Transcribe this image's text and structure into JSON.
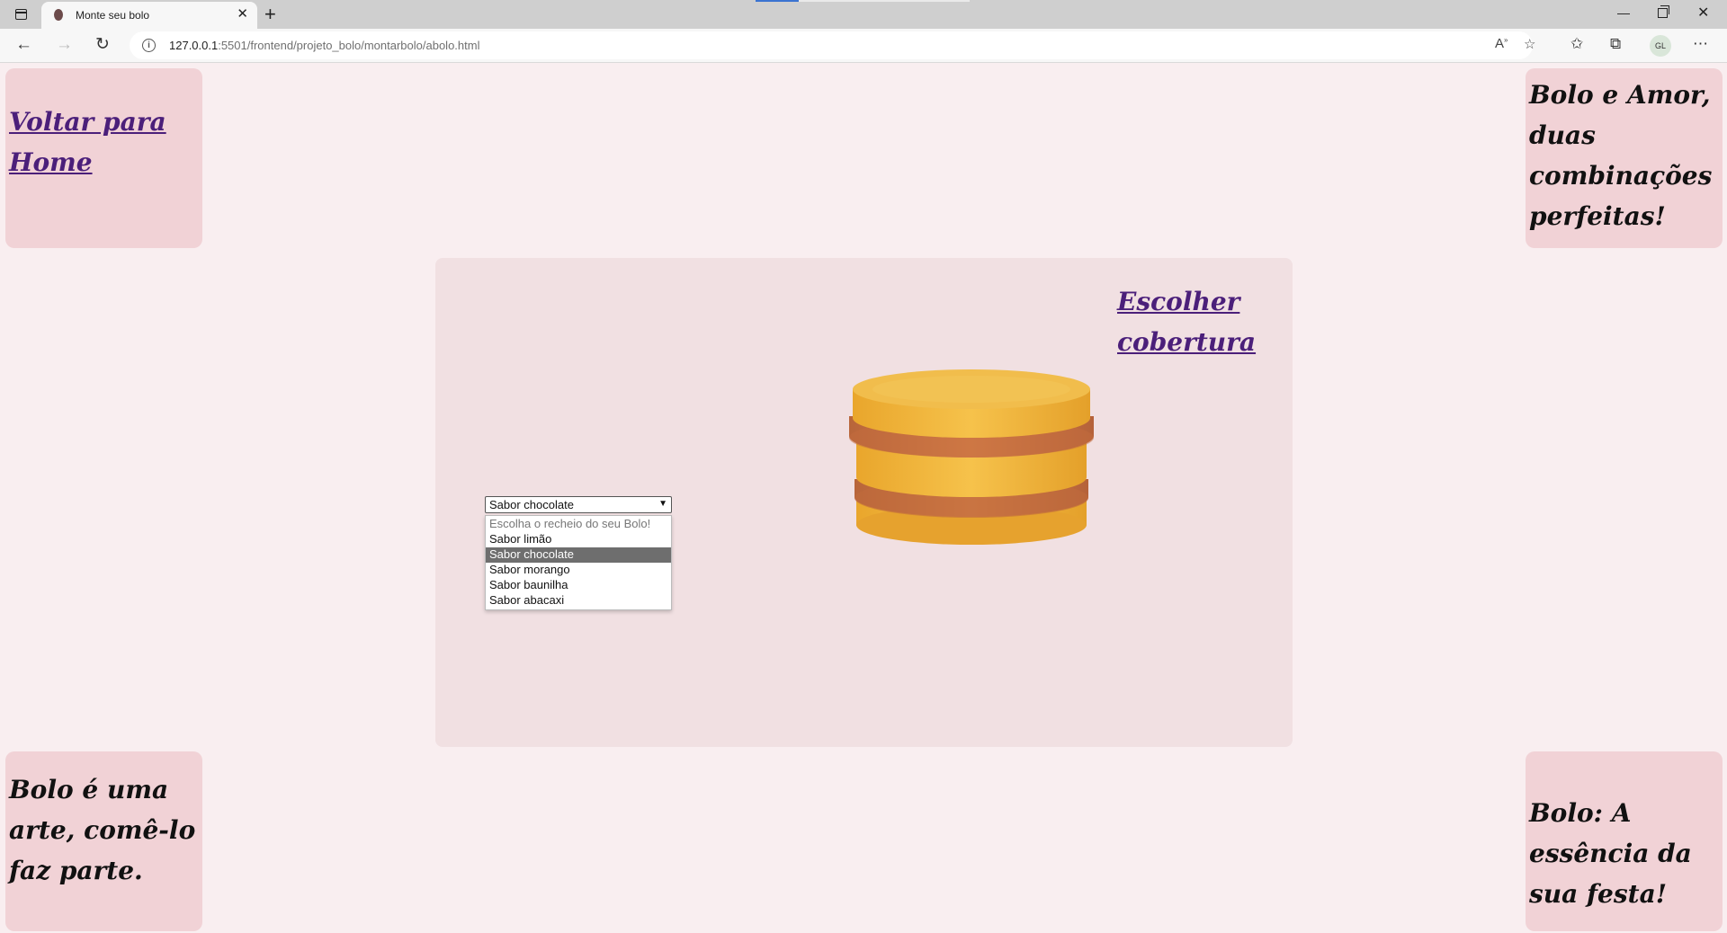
{
  "browser": {
    "tab_title": "Monte seu bolo",
    "url_host": "127.0.0.1",
    "url_rest": ":5501/frontend/projeto_bolo/montarbolo/abolo.html",
    "avatar_initials": "GL"
  },
  "page": {
    "home_link": "Voltar para Home",
    "quote_top_right": "Bolo e Amor, duas combinações perfeitas!",
    "quote_bottom_left": "Bolo é uma arte, comê-lo faz parte.",
    "quote_bottom_right": "Bolo: A essência da sua festa!",
    "choose_topping_link": "Escolher cobertura",
    "filling_select": {
      "selected": "Sabor chocolate",
      "options": [
        "Escolha o recheio do seu Bolo!",
        "Sabor limão",
        "Sabor chocolate",
        "Sabor morango",
        "Sabor baunilha",
        "Sabor abacaxi"
      ]
    }
  },
  "colors": {
    "page_bg": "#f9eef0",
    "card_bg": "#f1d2d6",
    "panel_bg": "#f1e0e2",
    "link": "#4b1f7a",
    "cake_sponge": "#f0b43a",
    "cake_filling": "#c9733f"
  }
}
